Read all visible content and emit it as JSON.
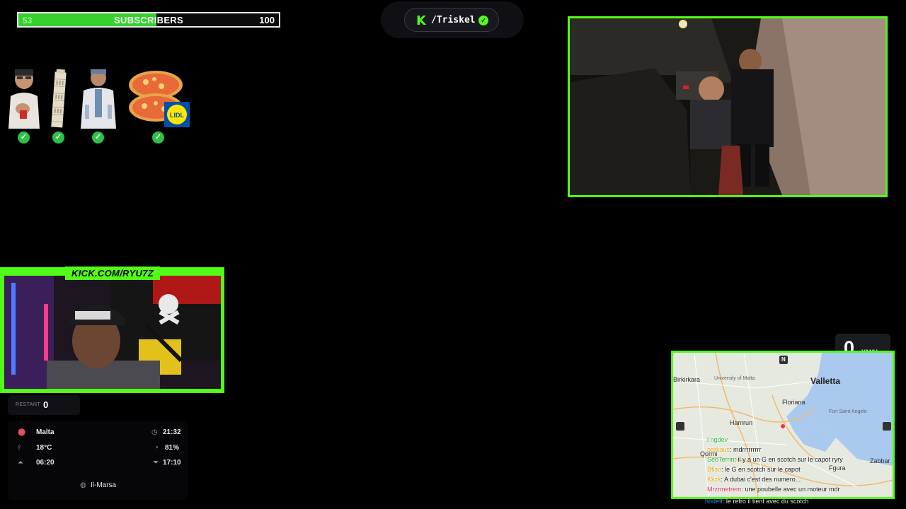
{
  "subscribers": {
    "current": "53",
    "label": "SUBSCRIBERS",
    "goal": "100",
    "progress": 0.53
  },
  "goals": [
    {
      "name": "person",
      "done": true
    },
    {
      "name": "tower-of-pisa",
      "done": true
    },
    {
      "name": "person-doctor",
      "done": true
    },
    {
      "name": "pizza-lidl",
      "done": true
    }
  ],
  "lidl_logo_text": "LIDL",
  "channel": {
    "logo": "K",
    "name": "/Triskel"
  },
  "webcam": {
    "url": "KICK.COM/RYU7Z"
  },
  "restant": {
    "label": "RESTANT",
    "value": "0"
  },
  "info": {
    "location": "Malta",
    "time": "21:32",
    "temperature": "18°C",
    "humidity": "81%",
    "sunrise": "06:20",
    "sunset": "17:10",
    "area": "Il-Marsa"
  },
  "speed": {
    "value": "0",
    "unit": "KM/H"
  },
  "map": {
    "labels": [
      "Valletta",
      "Birkirkara",
      "University of Malta",
      "Floriana",
      "Hamrun",
      "Fort Saint Angelo",
      "Qormi",
      "Fgura",
      "Zabbar"
    ],
    "compass": "N"
  },
  "chat": [
    {
      "user": "l ngdev",
      "message": "",
      "color": "#27b84a"
    },
    {
      "user": "parkaus",
      "message": ": mdrrrrrrrrr",
      "color": "#e8a81a"
    },
    {
      "user": "SebTerrin",
      "message": ": il y a un G en scotch sur le capot ryry",
      "color": "#27b84a"
    },
    {
      "user": "Bfiso",
      "message": ": le G en scotch sur le capot",
      "color": "#e8a81a"
    },
    {
      "user": "Kkzk",
      "message": ": A dubai c'est des numero...",
      "color": "#e8a81a"
    },
    {
      "user": "Mrzrmetrem",
      "message": ": une poubelle avec un moteur mdr",
      "color": "#e0306a"
    },
    {
      "user": "hodeff",
      "message": ": le retro il tient avec du scotch",
      "color": "#2a8ae0"
    }
  ],
  "colors": {
    "kick_green": "#53fc18",
    "progress_green": "#36d12e",
    "check_green": "#2ec14a"
  }
}
